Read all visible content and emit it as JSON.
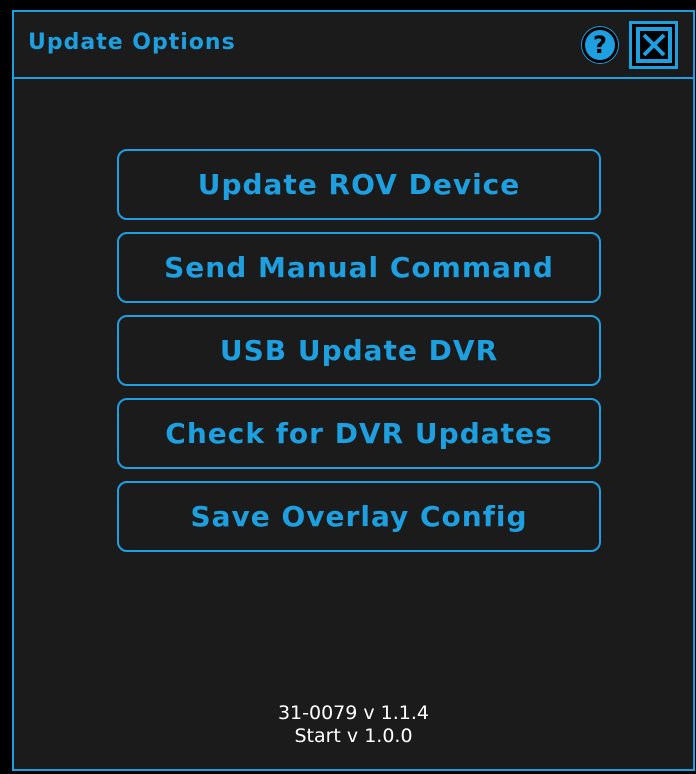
{
  "dialog": {
    "title": "Update Options",
    "help_glyph": "?",
    "help_icon": "help-icon",
    "close_icon": "close-icon"
  },
  "menu": {
    "buttons": [
      {
        "label": "Update ROV Device"
      },
      {
        "label": "Send Manual Command"
      },
      {
        "label": "USB Update DVR"
      },
      {
        "label": "Check for DVR Updates"
      },
      {
        "label": "Save Overlay Config"
      }
    ]
  },
  "versions": {
    "firmware": "31-0079 v 1.1.4",
    "start": "Start v 1.0.0"
  },
  "colors": {
    "accent": "#1e9fe0",
    "panel_background": "#1b1b1b",
    "page_background": "#000000",
    "version_text": "#ffffff"
  }
}
